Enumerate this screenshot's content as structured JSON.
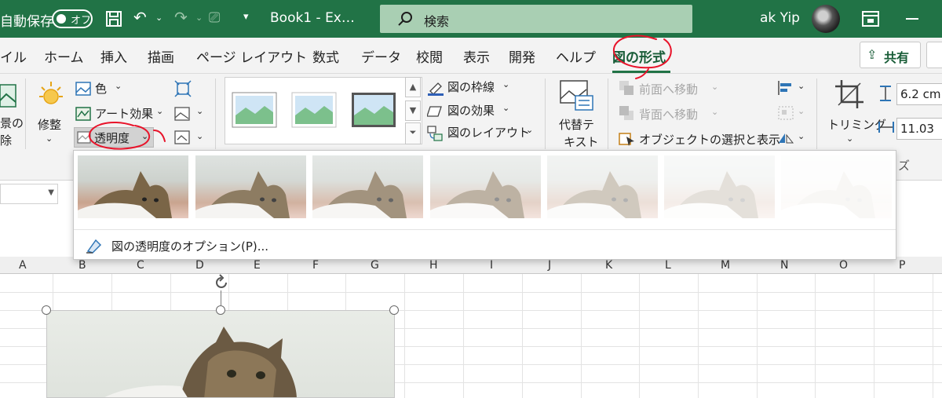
{
  "titlebar": {
    "autosave_label": "自動保存",
    "autosave_state": "オフ",
    "filename": "Book1  -  Ex…",
    "search_placeholder": "検索",
    "user_name": "ak Yip"
  },
  "tabs": [
    "イル",
    "ホーム",
    "挿入",
    "描画",
    "ページ レイアウト",
    "数式",
    "データ",
    "校閲",
    "表示",
    "開発",
    "ヘルプ",
    "図の形式"
  ],
  "active_tab": "図の形式",
  "share_label": "共有",
  "ribbon": {
    "remove_bg": [
      "景の",
      "除"
    ],
    "corrections": "修整",
    "color": "色",
    "artistic_effects": "アート効果",
    "transparency": "透明度",
    "picture_border": "図の枠線",
    "picture_effects": "図の効果",
    "picture_layout": "図のレイアウト",
    "alt_text": [
      "代替テ",
      "キスト"
    ],
    "bring_forward": "前面へ移動",
    "send_backward": "背面へ移動",
    "selection_pane": "オブジェクトの選択と表示",
    "crop": "トリミング",
    "height": "6.2 cm",
    "width": "11.03",
    "size_group": "ズ"
  },
  "columns": [
    "A",
    "B",
    "C",
    "D",
    "E",
    "F",
    "G",
    "H",
    "I",
    "J",
    "K",
    "L",
    "M",
    "N",
    "O",
    "P"
  ],
  "transparency_menu": {
    "presets": [
      "0%",
      "15%",
      "30%",
      "50%",
      "65%",
      "80%",
      "95%"
    ],
    "preset_opacity": [
      1.0,
      0.85,
      0.7,
      0.5,
      0.35,
      0.2,
      0.05
    ],
    "options_label": "図の透明度のオプション(P)..."
  },
  "colors": {
    "excel_green": "#217346",
    "annotation_red": "#e8132a"
  }
}
